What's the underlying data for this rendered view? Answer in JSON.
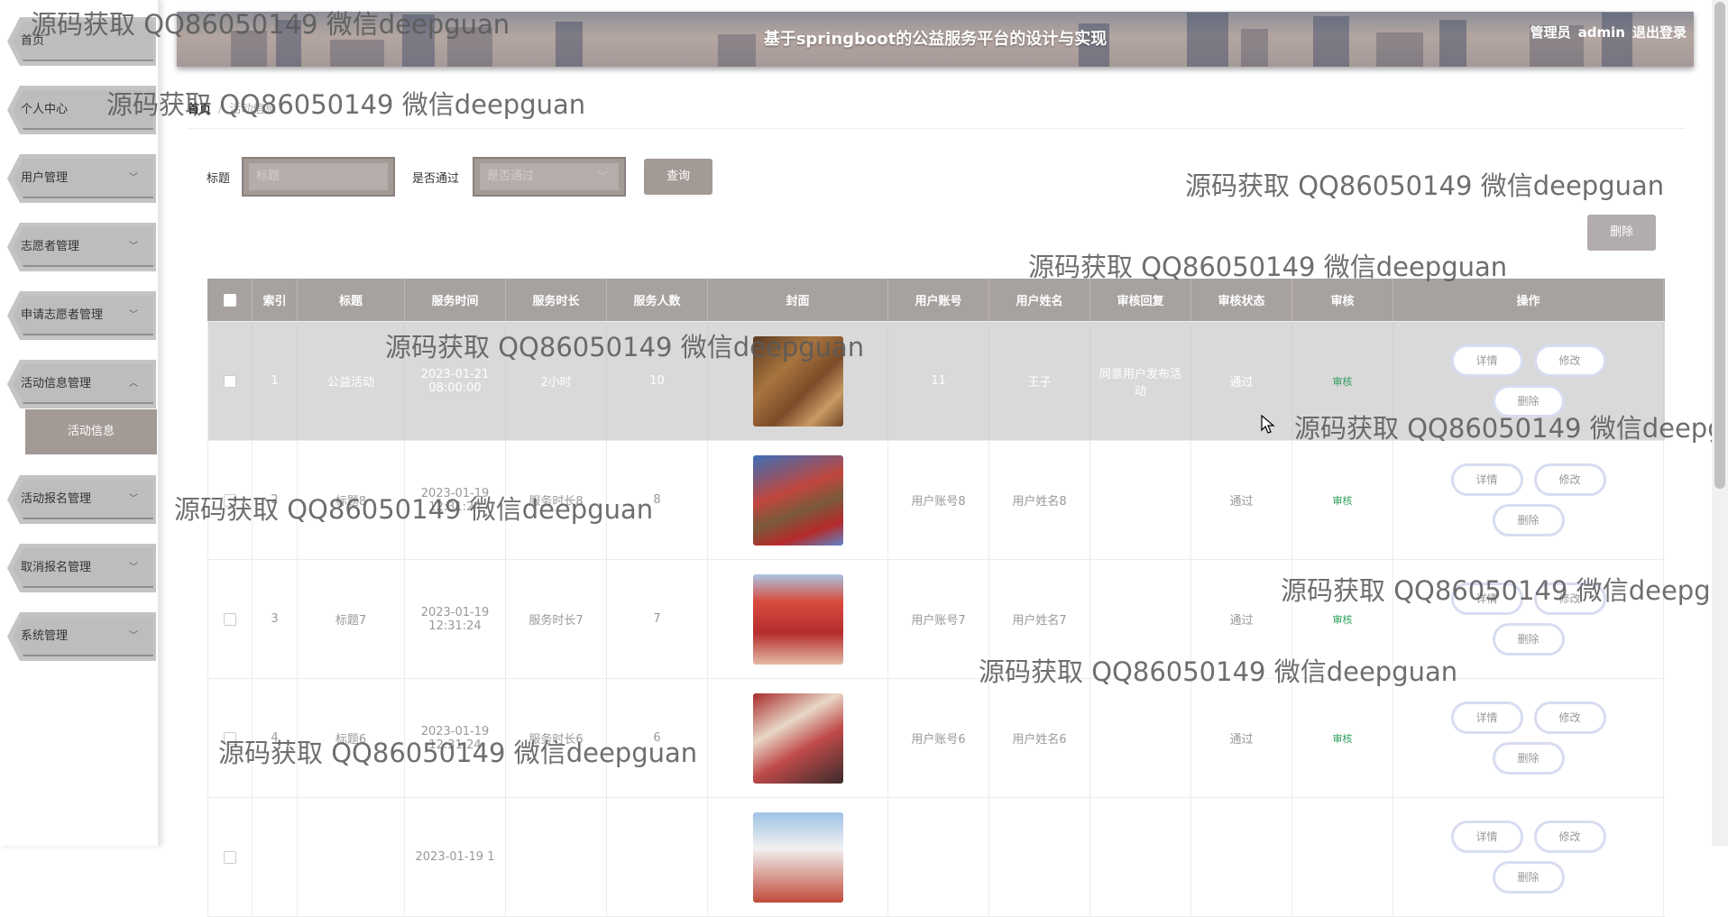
{
  "sidebar": {
    "items": [
      {
        "label": "首页",
        "chevron": ""
      },
      {
        "label": "个人中心",
        "chevron": ""
      },
      {
        "label": "用户管理",
        "chevron": "﹀"
      },
      {
        "label": "志愿者管理",
        "chevron": "﹀"
      },
      {
        "label": "申请志愿者管理",
        "chevron": "﹀"
      },
      {
        "label": "活动信息管理",
        "chevron": "︿"
      },
      {
        "label": "活动报名管理",
        "chevron": "﹀"
      },
      {
        "label": "取消报名管理",
        "chevron": "﹀"
      },
      {
        "label": "系统管理",
        "chevron": "﹀"
      }
    ],
    "active_submenu": "活动信息"
  },
  "header": {
    "title": "基于springboot的公益服务平台的设计与实现",
    "user_role": "管理员",
    "username": "admin",
    "logout": "退出登录"
  },
  "breadcrumb": {
    "home": "首页",
    "separator": "/",
    "current": "活动信息"
  },
  "search": {
    "title_label": "标题",
    "title_placeholder": "标题",
    "pass_label": "是否通过",
    "pass_placeholder": "是否通过",
    "query_button": "查询"
  },
  "toolbar": {
    "delete_button": "删除"
  },
  "table": {
    "columns": [
      "",
      "索引",
      "标题",
      "服务时间",
      "服务时长",
      "服务人数",
      "封面",
      "用户账号",
      "用户姓名",
      "审核回复",
      "审核状态",
      "审核",
      "操作"
    ],
    "rows": [
      {
        "index": "1",
        "title": "公益活动",
        "time": "2023-01-21 08:00:00",
        "duration": "2小时",
        "people": "10",
        "account": "11",
        "name": "王子",
        "reply": "同意用户发布活动",
        "status": "通过",
        "audit": "审核"
      },
      {
        "index": "2",
        "title": "标题8",
        "time": "2023-01-19 12:31:24",
        "duration": "服务时长8",
        "people": "8",
        "account": "用户账号8",
        "name": "用户姓名8",
        "reply": "",
        "status": "通过",
        "audit": "审核"
      },
      {
        "index": "3",
        "title": "标题7",
        "time": "2023-01-19 12:31:24",
        "duration": "服务时长7",
        "people": "7",
        "account": "用户账号7",
        "name": "用户姓名7",
        "reply": "",
        "status": "通过",
        "audit": "审核"
      },
      {
        "index": "4",
        "title": "标题6",
        "time": "2023-01-19 12:31:24",
        "duration": "服务时长6",
        "people": "6",
        "account": "用户账号6",
        "name": "用户姓名6",
        "reply": "",
        "status": "通过",
        "audit": "审核"
      },
      {
        "index": "",
        "title": "",
        "time": "2023-01-19 1",
        "duration": "",
        "people": "",
        "account": "",
        "name": "",
        "reply": "",
        "status": "",
        "audit": ""
      }
    ],
    "ops": {
      "detail": "详情",
      "edit": "修改",
      "delete": "删除"
    }
  },
  "watermark": "源码获取 QQ86050149 微信deepguan"
}
